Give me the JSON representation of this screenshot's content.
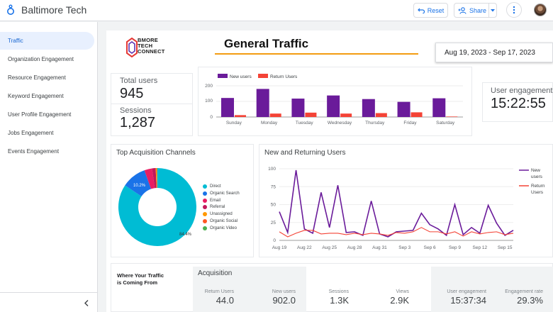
{
  "app": {
    "title": "Baltimore Tech"
  },
  "toolbar": {
    "reset_label": "Reset",
    "share_label": "Share"
  },
  "colors": {
    "accent": "#1a73e8",
    "purple": "#6a1b9a",
    "red": "#f44336",
    "teal": "#00bcd4",
    "orange": "#f39c12"
  },
  "sidebar": {
    "items": [
      {
        "label": "Traffic",
        "active": true
      },
      {
        "label": "Organization Engagement"
      },
      {
        "label": "Resource Engagement"
      },
      {
        "label": "Keyword Engagement"
      },
      {
        "label": "User Profile Engagement"
      },
      {
        "label": "Jobs Engagement"
      },
      {
        "label": "Events Engagement"
      }
    ]
  },
  "report": {
    "logo_text": [
      "BMORE",
      "TECH",
      "CONNECT"
    ],
    "title": "General Traffic",
    "date_range": "Aug 19, 2023 - Sep 17, 2023"
  },
  "metrics": {
    "total_users_label": "Total users",
    "total_users_value": "945",
    "sessions_label": "Sessions",
    "sessions_value": "1,287",
    "engagement_label": "User engagement",
    "engagement_value": "15:22:55"
  },
  "bar_chart": {
    "type": "bar",
    "categories": [
      "Sunday",
      "Monday",
      "Tuesday",
      "Wednesday",
      "Thursday",
      "Friday",
      "Saturday"
    ],
    "series": [
      {
        "name": "New users",
        "color": "#6a1b9a",
        "values": [
          122,
          180,
          118,
          138,
          115,
          97,
          120
        ]
      },
      {
        "name": "Return Users",
        "color": "#f44336",
        "values": [
          12,
          22,
          28,
          22,
          25,
          30,
          3
        ]
      }
    ],
    "ylim": [
      0,
      200
    ],
    "yticks": [
      "200",
      "100",
      "0"
    ]
  },
  "pie_chart": {
    "title": "Top Acquisition Channels",
    "type": "pie",
    "slices": [
      {
        "name": "Direct",
        "value": 84.4,
        "color": "#00bcd4"
      },
      {
        "name": "Organic Search",
        "value": 10.2,
        "color": "#1a73e8"
      },
      {
        "name": "Email",
        "value": 3.2,
        "color": "#e91e63"
      },
      {
        "name": "Referral",
        "value": 1.5,
        "color": "#c2185b"
      },
      {
        "name": "Unassigned",
        "value": 0.4,
        "color": "#ff9800"
      },
      {
        "name": "Organic Social",
        "value": 0.2,
        "color": "#ff5722"
      },
      {
        "name": "Organic Video",
        "value": 0.1,
        "color": "#4caf50"
      }
    ],
    "labels": [
      "84.4%",
      "10.2%"
    ]
  },
  "line_chart": {
    "title": "New and Returning Users",
    "type": "line",
    "x_ticks": [
      "Aug 19",
      "Aug 22",
      "Aug 25",
      "Aug 28",
      "Aug 31",
      "Sep 3",
      "Sep 6",
      "Sep 9",
      "Sep 12",
      "Sep 15"
    ],
    "ylim": [
      0,
      100
    ],
    "yticks": [
      "100",
      "75",
      "50",
      "25",
      "0"
    ],
    "series": [
      {
        "name": "New users",
        "color": "#6a1b9a",
        "values": [
          40,
          11,
          98,
          16,
          10,
          67,
          18,
          77,
          11,
          12,
          7,
          55,
          9,
          5,
          12,
          13,
          14,
          38,
          22,
          16,
          7,
          50,
          8,
          18,
          10,
          49,
          24,
          7,
          14
        ]
      },
      {
        "name": "Return Users",
        "color": "#f44336",
        "values": [
          12,
          5,
          10,
          14,
          14,
          9,
          10,
          10,
          8,
          10,
          8,
          10,
          9,
          7,
          11,
          10,
          12,
          18,
          12,
          12,
          9,
          12,
          6,
          12,
          9,
          11,
          12,
          8,
          10
        ]
      }
    ],
    "legend": [
      "New users",
      "Return Users"
    ]
  },
  "acquisition": {
    "where_text": "Where Your Traffic is Coming From",
    "title": "Acquisition",
    "stats": [
      {
        "label": "Return Users",
        "value": "44.0"
      },
      {
        "label": "New users",
        "value": "902.0"
      },
      {
        "label": "Sessions",
        "value": "1.3K"
      },
      {
        "label": "Views",
        "value": "2.9K"
      },
      {
        "label": "User engagement",
        "value": "15:37:34"
      },
      {
        "label": "Engagement rate",
        "value": "29.3%"
      }
    ]
  }
}
